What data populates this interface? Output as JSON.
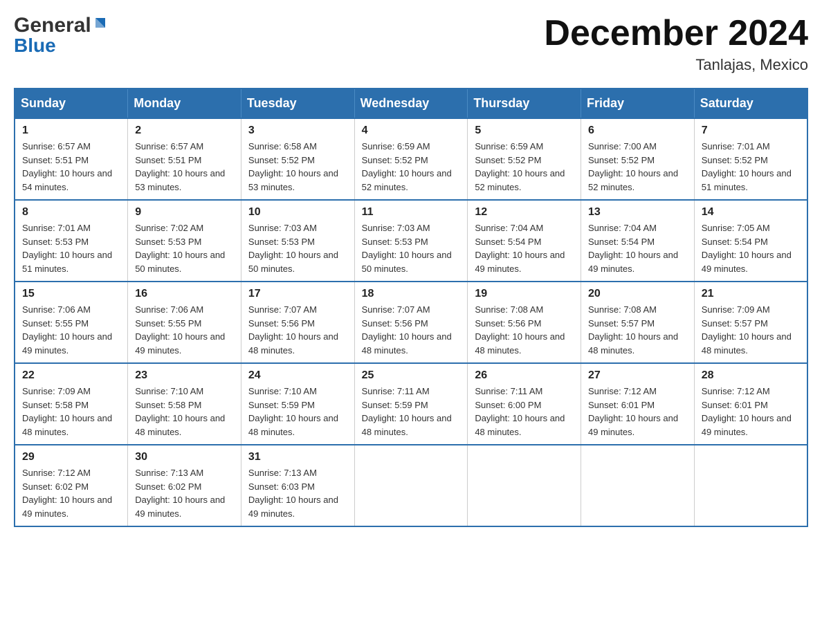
{
  "header": {
    "logo_general": "General",
    "logo_blue": "Blue",
    "month_title": "December 2024",
    "location": "Tanlajas, Mexico"
  },
  "days_of_week": [
    "Sunday",
    "Monday",
    "Tuesday",
    "Wednesday",
    "Thursday",
    "Friday",
    "Saturday"
  ],
  "weeks": [
    [
      {
        "day": "1",
        "sunrise": "6:57 AM",
        "sunset": "5:51 PM",
        "daylight": "10 hours and 54 minutes."
      },
      {
        "day": "2",
        "sunrise": "6:57 AM",
        "sunset": "5:51 PM",
        "daylight": "10 hours and 53 minutes."
      },
      {
        "day": "3",
        "sunrise": "6:58 AM",
        "sunset": "5:52 PM",
        "daylight": "10 hours and 53 minutes."
      },
      {
        "day": "4",
        "sunrise": "6:59 AM",
        "sunset": "5:52 PM",
        "daylight": "10 hours and 52 minutes."
      },
      {
        "day": "5",
        "sunrise": "6:59 AM",
        "sunset": "5:52 PM",
        "daylight": "10 hours and 52 minutes."
      },
      {
        "day": "6",
        "sunrise": "7:00 AM",
        "sunset": "5:52 PM",
        "daylight": "10 hours and 52 minutes."
      },
      {
        "day": "7",
        "sunrise": "7:01 AM",
        "sunset": "5:52 PM",
        "daylight": "10 hours and 51 minutes."
      }
    ],
    [
      {
        "day": "8",
        "sunrise": "7:01 AM",
        "sunset": "5:53 PM",
        "daylight": "10 hours and 51 minutes."
      },
      {
        "day": "9",
        "sunrise": "7:02 AM",
        "sunset": "5:53 PM",
        "daylight": "10 hours and 50 minutes."
      },
      {
        "day": "10",
        "sunrise": "7:03 AM",
        "sunset": "5:53 PM",
        "daylight": "10 hours and 50 minutes."
      },
      {
        "day": "11",
        "sunrise": "7:03 AM",
        "sunset": "5:53 PM",
        "daylight": "10 hours and 50 minutes."
      },
      {
        "day": "12",
        "sunrise": "7:04 AM",
        "sunset": "5:54 PM",
        "daylight": "10 hours and 49 minutes."
      },
      {
        "day": "13",
        "sunrise": "7:04 AM",
        "sunset": "5:54 PM",
        "daylight": "10 hours and 49 minutes."
      },
      {
        "day": "14",
        "sunrise": "7:05 AM",
        "sunset": "5:54 PM",
        "daylight": "10 hours and 49 minutes."
      }
    ],
    [
      {
        "day": "15",
        "sunrise": "7:06 AM",
        "sunset": "5:55 PM",
        "daylight": "10 hours and 49 minutes."
      },
      {
        "day": "16",
        "sunrise": "7:06 AM",
        "sunset": "5:55 PM",
        "daylight": "10 hours and 49 minutes."
      },
      {
        "day": "17",
        "sunrise": "7:07 AM",
        "sunset": "5:56 PM",
        "daylight": "10 hours and 48 minutes."
      },
      {
        "day": "18",
        "sunrise": "7:07 AM",
        "sunset": "5:56 PM",
        "daylight": "10 hours and 48 minutes."
      },
      {
        "day": "19",
        "sunrise": "7:08 AM",
        "sunset": "5:56 PM",
        "daylight": "10 hours and 48 minutes."
      },
      {
        "day": "20",
        "sunrise": "7:08 AM",
        "sunset": "5:57 PM",
        "daylight": "10 hours and 48 minutes."
      },
      {
        "day": "21",
        "sunrise": "7:09 AM",
        "sunset": "5:57 PM",
        "daylight": "10 hours and 48 minutes."
      }
    ],
    [
      {
        "day": "22",
        "sunrise": "7:09 AM",
        "sunset": "5:58 PM",
        "daylight": "10 hours and 48 minutes."
      },
      {
        "day": "23",
        "sunrise": "7:10 AM",
        "sunset": "5:58 PM",
        "daylight": "10 hours and 48 minutes."
      },
      {
        "day": "24",
        "sunrise": "7:10 AM",
        "sunset": "5:59 PM",
        "daylight": "10 hours and 48 minutes."
      },
      {
        "day": "25",
        "sunrise": "7:11 AM",
        "sunset": "5:59 PM",
        "daylight": "10 hours and 48 minutes."
      },
      {
        "day": "26",
        "sunrise": "7:11 AM",
        "sunset": "6:00 PM",
        "daylight": "10 hours and 48 minutes."
      },
      {
        "day": "27",
        "sunrise": "7:12 AM",
        "sunset": "6:01 PM",
        "daylight": "10 hours and 49 minutes."
      },
      {
        "day": "28",
        "sunrise": "7:12 AM",
        "sunset": "6:01 PM",
        "daylight": "10 hours and 49 minutes."
      }
    ],
    [
      {
        "day": "29",
        "sunrise": "7:12 AM",
        "sunset": "6:02 PM",
        "daylight": "10 hours and 49 minutes."
      },
      {
        "day": "30",
        "sunrise": "7:13 AM",
        "sunset": "6:02 PM",
        "daylight": "10 hours and 49 minutes."
      },
      {
        "day": "31",
        "sunrise": "7:13 AM",
        "sunset": "6:03 PM",
        "daylight": "10 hours and 49 minutes."
      },
      null,
      null,
      null,
      null
    ]
  ]
}
